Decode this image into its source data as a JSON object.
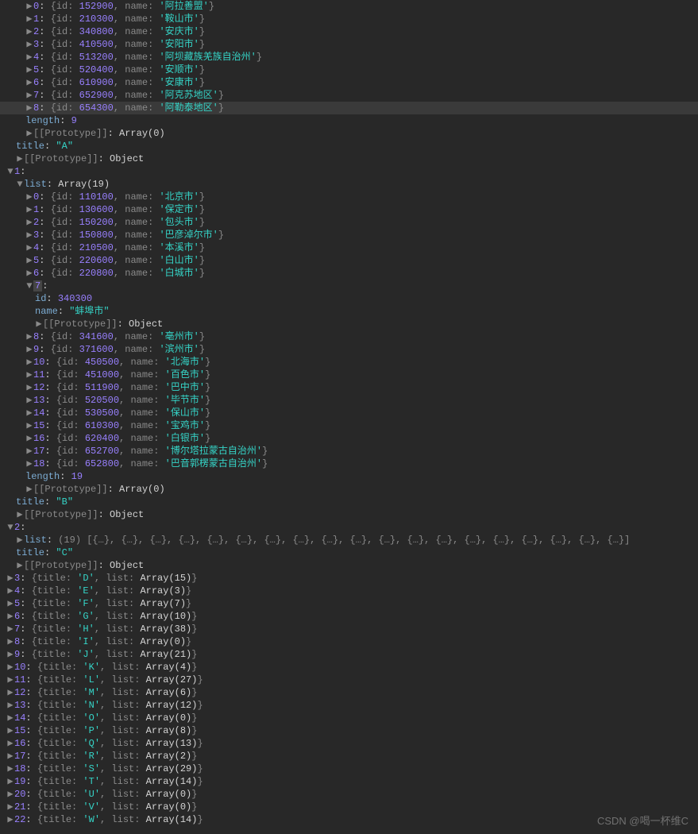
{
  "groups": [
    {
      "title": "A",
      "length": 9,
      "items": [
        {
          "idx": 0,
          "id": 152900,
          "name": "阿拉善盟"
        },
        {
          "idx": 1,
          "id": 210300,
          "name": "鞍山市"
        },
        {
          "idx": 2,
          "id": 340800,
          "name": "安庆市"
        },
        {
          "idx": 3,
          "id": 410500,
          "name": "安阳市"
        },
        {
          "idx": 4,
          "id": 513200,
          "name": "阿坝藏族羌族自治州"
        },
        {
          "idx": 5,
          "id": 520400,
          "name": "安顺市"
        },
        {
          "idx": 6,
          "id": 610900,
          "name": "安康市"
        },
        {
          "idx": 7,
          "id": 652900,
          "name": "阿克苏地区"
        },
        {
          "idx": 8,
          "id": 654300,
          "name": "阿勒泰地区",
          "hl": true
        }
      ]
    },
    {
      "title": "B",
      "length": 19,
      "items": [
        {
          "idx": 0,
          "id": 110100,
          "name": "北京市"
        },
        {
          "idx": 1,
          "id": 130600,
          "name": "保定市"
        },
        {
          "idx": 2,
          "id": 150200,
          "name": "包头市"
        },
        {
          "idx": 3,
          "id": 150800,
          "name": "巴彦淖尔市"
        },
        {
          "idx": 4,
          "id": 210500,
          "name": "本溪市"
        },
        {
          "idx": 5,
          "id": 220600,
          "name": "白山市"
        },
        {
          "idx": 6,
          "id": 220800,
          "name": "白城市"
        },
        {
          "idx": 7,
          "id": 340300,
          "name": "蚌埠市",
          "expanded": true
        },
        {
          "idx": 8,
          "id": 341600,
          "name": "亳州市"
        },
        {
          "idx": 9,
          "id": 371600,
          "name": "滨州市"
        },
        {
          "idx": 10,
          "id": 450500,
          "name": "北海市"
        },
        {
          "idx": 11,
          "id": 451000,
          "name": "百色市"
        },
        {
          "idx": 12,
          "id": 511900,
          "name": "巴中市"
        },
        {
          "idx": 13,
          "id": 520500,
          "name": "毕节市"
        },
        {
          "idx": 14,
          "id": 530500,
          "name": "保山市"
        },
        {
          "idx": 15,
          "id": 610300,
          "name": "宝鸡市"
        },
        {
          "idx": 16,
          "id": 620400,
          "name": "白银市"
        },
        {
          "idx": 17,
          "id": 652700,
          "name": "博尔塔拉蒙古自治州"
        },
        {
          "idx": 18,
          "id": 652800,
          "name": "巴音郭楞蒙古自治州"
        }
      ]
    }
  ],
  "groupC": {
    "title": "C",
    "count": 19,
    "placeholderCount": 19
  },
  "closedGroups": [
    {
      "idx": 3,
      "title": "D",
      "count": 15
    },
    {
      "idx": 4,
      "title": "E",
      "count": 3
    },
    {
      "idx": 5,
      "title": "F",
      "count": 7
    },
    {
      "idx": 6,
      "title": "G",
      "count": 10
    },
    {
      "idx": 7,
      "title": "H",
      "count": 38
    },
    {
      "idx": 8,
      "title": "I",
      "count": 0
    },
    {
      "idx": 9,
      "title": "J",
      "count": 21
    },
    {
      "idx": 10,
      "title": "K",
      "count": 4
    },
    {
      "idx": 11,
      "title": "L",
      "count": 27
    },
    {
      "idx": 12,
      "title": "M",
      "count": 6
    },
    {
      "idx": 13,
      "title": "N",
      "count": 12
    },
    {
      "idx": 14,
      "title": "O",
      "count": 0
    },
    {
      "idx": 15,
      "title": "P",
      "count": 8
    },
    {
      "idx": 16,
      "title": "Q",
      "count": 13
    },
    {
      "idx": 17,
      "title": "R",
      "count": 2
    },
    {
      "idx": 18,
      "title": "S",
      "count": 29
    },
    {
      "idx": 19,
      "title": "T",
      "count": 14
    },
    {
      "idx": 20,
      "title": "U",
      "count": 0
    },
    {
      "idx": 21,
      "title": "V",
      "count": 0
    },
    {
      "idx": 22,
      "title": "W",
      "count": 14
    }
  ],
  "labels": {
    "list": "list",
    "array": "Array",
    "length": "length",
    "prototype": "[[Prototype]]",
    "object": "Object",
    "title": "title",
    "id": "id",
    "name": "name"
  },
  "watermark": "CSDN @喝一杯维C"
}
